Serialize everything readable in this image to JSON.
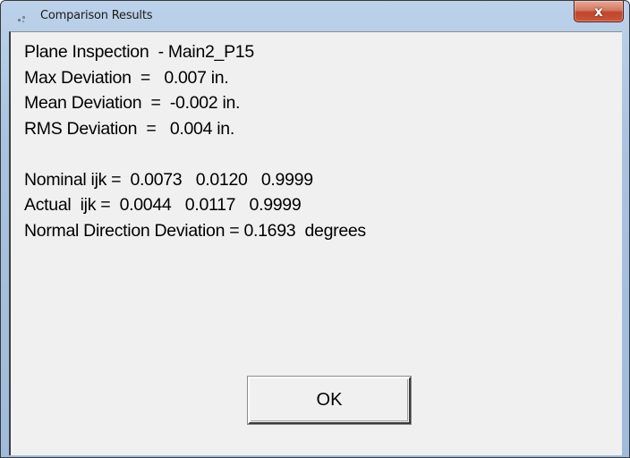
{
  "window": {
    "title": "Comparison Results",
    "close_glyph": "x",
    "app_icon": "window-app-icon",
    "accent": "#a9c3e0",
    "close_color": "#c2452a"
  },
  "results": {
    "lines": [
      "Plane Inspection  - Main2_P15",
      "Max Deviation  =   0.007 in.",
      "Mean Deviation  =  -0.002 in.",
      "RMS Deviation  =   0.004 in.",
      "",
      "Nominal ijk =  0.0073   0.0120   0.9999",
      "Actual  ijk =  0.0044   0.0117   0.9999",
      "Normal Direction Deviation = 0.1693  degrees"
    ]
  },
  "buttons": {
    "ok_label": "OK"
  }
}
